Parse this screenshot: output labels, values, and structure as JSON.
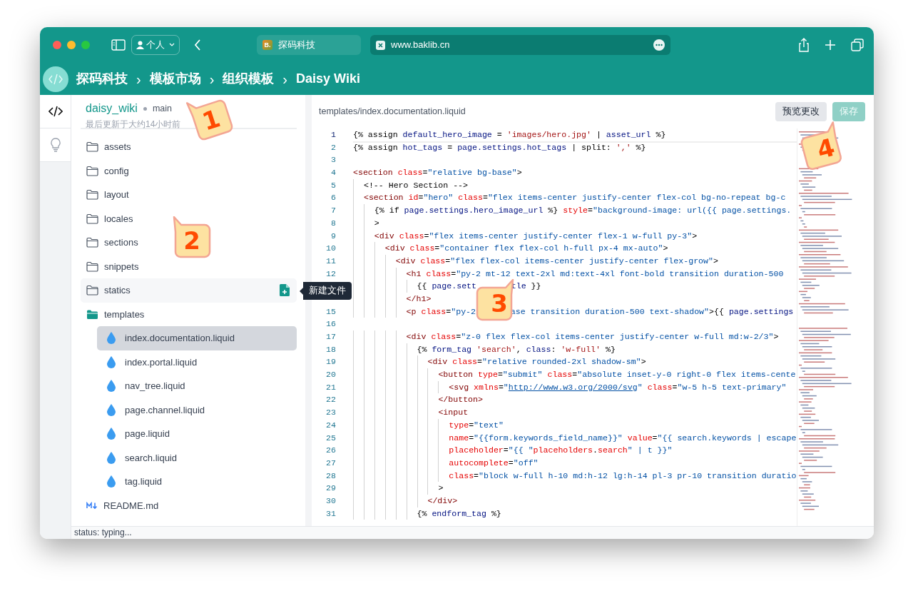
{
  "browser": {
    "profile": "个人",
    "tabs": [
      {
        "title": "探码科技",
        "icon_text": "B.",
        "selected": false
      },
      {
        "title": "www.baklib.cn",
        "selected": true
      }
    ]
  },
  "app_header": {
    "breadcrumb": [
      "探码科技",
      "模板市场",
      "组织模板",
      "Daisy Wiki"
    ],
    "separators": [
      "›",
      "›",
      "›"
    ]
  },
  "rail": [
    {
      "kind": "code",
      "selected": true
    },
    {
      "kind": "bulb",
      "selected": false
    }
  ],
  "repo": {
    "name": "daisy_wiki",
    "branch": "main",
    "updated": "最后更新于大约14小时前"
  },
  "tree": [
    {
      "name": "assets",
      "kind": "folder",
      "expanded": false,
      "selected": false,
      "hovered": false
    },
    {
      "name": "config",
      "kind": "folder",
      "expanded": false,
      "selected": false,
      "hovered": false
    },
    {
      "name": "layout",
      "kind": "folder",
      "expanded": false,
      "selected": false,
      "hovered": false
    },
    {
      "name": "locales",
      "kind": "folder",
      "expanded": false,
      "selected": false,
      "hovered": false
    },
    {
      "name": "sections",
      "kind": "folder",
      "expanded": false,
      "selected": false,
      "hovered": false
    },
    {
      "name": "snippets",
      "kind": "folder",
      "expanded": false,
      "selected": false,
      "hovered": false
    },
    {
      "name": "statics",
      "kind": "folder",
      "expanded": false,
      "selected": false,
      "hovered": true
    },
    {
      "name": "templates",
      "kind": "folder",
      "expanded": true,
      "selected": false,
      "hovered": false,
      "children": [
        {
          "name": "index.documentation.liquid",
          "kind": "liquid",
          "selected": true,
          "hovered": false
        },
        {
          "name": "index.portal.liquid",
          "kind": "liquid",
          "selected": false,
          "hovered": false
        },
        {
          "name": "nav_tree.liquid",
          "kind": "liquid",
          "selected": false,
          "hovered": false
        },
        {
          "name": "page.channel.liquid",
          "kind": "liquid",
          "selected": false,
          "hovered": false
        },
        {
          "name": "page.liquid",
          "kind": "liquid",
          "selected": false,
          "hovered": false
        },
        {
          "name": "search.liquid",
          "kind": "liquid",
          "selected": false,
          "hovered": false
        },
        {
          "name": "tag.liquid",
          "kind": "liquid",
          "selected": false,
          "hovered": false
        }
      ]
    },
    {
      "name": "README.md",
      "kind": "markdown",
      "selected": false,
      "hovered": false
    }
  ],
  "tooltip": "新建文件",
  "editor": {
    "path": "templates/index.documentation.liquid",
    "buttons": [
      {
        "label": "预览更改",
        "kind": "secondary",
        "disabled": false
      },
      {
        "label": "保存",
        "kind": "primary",
        "disabled": true
      }
    ],
    "lines": [
      {
        "number": "1",
        "selected": true,
        "tokens": [
          {
            "kind": "plain",
            "text": "{% assign "
          },
          {
            "kind": "var",
            "text": "default_hero_image"
          },
          {
            "kind": "plain",
            "text": " = "
          },
          {
            "kind": "lstr",
            "text": "'images/hero.jpg'"
          },
          {
            "kind": "plain",
            "text": " | "
          },
          {
            "kind": "var",
            "text": "asset_url"
          },
          {
            "kind": "plain",
            "text": " %}"
          }
        ]
      },
      {
        "number": "2",
        "selected": false,
        "tokens": [
          {
            "kind": "plain",
            "text": "{% assign "
          },
          {
            "kind": "var",
            "text": "hot_tags"
          },
          {
            "kind": "plain",
            "text": " = "
          },
          {
            "kind": "var",
            "text": "page.settings.hot_tags"
          },
          {
            "kind": "plain",
            "text": " | split: "
          },
          {
            "kind": "lstr",
            "text": "','"
          },
          {
            "kind": "plain",
            "text": " %}"
          }
        ]
      },
      {
        "number": "3",
        "selected": false
      },
      {
        "number": "4",
        "selected": false,
        "tokens": [
          {
            "kind": "tag",
            "text": "<section"
          },
          {
            "kind": "attr",
            "text": " class"
          },
          {
            "kind": "plain",
            "text": "="
          },
          {
            "kind": "str",
            "text": "\"relative bg-base\""
          },
          {
            "kind": "plain",
            "text": ">"
          }
        ]
      },
      {
        "number": "5",
        "selected": false,
        "tokens": [
          {
            "kind": "plain",
            "text": "  <!-- Hero Section -->"
          }
        ]
      },
      {
        "number": "6",
        "selected": false,
        "tokens": [
          {
            "kind": "tag",
            "text": "  <section"
          },
          {
            "kind": "attr",
            "text": " id"
          },
          {
            "kind": "plain",
            "text": "="
          },
          {
            "kind": "str",
            "text": "\"hero\""
          },
          {
            "kind": "attr",
            "text": " class"
          },
          {
            "kind": "plain",
            "text": "="
          },
          {
            "kind": "str",
            "text": "\"flex items-center justify-center flex-col bg-no-repeat bg-c"
          }
        ]
      },
      {
        "number": "7",
        "selected": false,
        "tokens": [
          {
            "kind": "plain",
            "text": "    {% if "
          },
          {
            "kind": "var",
            "text": "page.settings.hero_image_url"
          },
          {
            "kind": "plain",
            "text": " %} "
          },
          {
            "kind": "attr",
            "text": "style"
          },
          {
            "kind": "plain",
            "text": "="
          },
          {
            "kind": "str",
            "text": "\"background-image: url({{ page.settings."
          }
        ]
      },
      {
        "number": "8",
        "selected": false,
        "tokens": [
          {
            "kind": "plain",
            "text": "    >"
          }
        ]
      },
      {
        "number": "9",
        "selected": false,
        "tokens": [
          {
            "kind": "tag",
            "text": "    <div"
          },
          {
            "kind": "attr",
            "text": " class"
          },
          {
            "kind": "plain",
            "text": "="
          },
          {
            "kind": "str",
            "text": "\"flex items-center justify-center flex-1 w-full py-3\""
          },
          {
            "kind": "plain",
            "text": ">"
          }
        ]
      },
      {
        "number": "10",
        "selected": false,
        "tokens": [
          {
            "kind": "tag",
            "text": "      <div"
          },
          {
            "kind": "attr",
            "text": " class"
          },
          {
            "kind": "plain",
            "text": "="
          },
          {
            "kind": "str",
            "text": "\"container flex flex-col h-full px-4 mx-auto\""
          },
          {
            "kind": "plain",
            "text": ">"
          }
        ]
      },
      {
        "number": "11",
        "selected": false,
        "tokens": [
          {
            "kind": "tag",
            "text": "        <div"
          },
          {
            "kind": "attr",
            "text": " class"
          },
          {
            "kind": "plain",
            "text": "="
          },
          {
            "kind": "str",
            "text": "\"flex flex-col items-center justify-center flex-grow\""
          },
          {
            "kind": "plain",
            "text": ">"
          }
        ]
      },
      {
        "number": "12",
        "selected": false,
        "tokens": [
          {
            "kind": "tag",
            "text": "          <h1"
          },
          {
            "kind": "attr",
            "text": " class"
          },
          {
            "kind": "plain",
            "text": "="
          },
          {
            "kind": "str",
            "text": "\"py-2 mt-12 text-2xl md:text-4xl font-bold transition duration-500"
          }
        ]
      },
      {
        "selected": false,
        "tokens": [
          {
            "kind": "plain",
            "text": "            {{ "
          },
          {
            "kind": "var",
            "text": "page.sett"
          },
          {
            "kind": "covered"
          },
          {
            "kind": "var",
            "text": "tle"
          },
          {
            "kind": "plain",
            "text": " }}"
          }
        ]
      },
      {
        "selected": false,
        "tokens": [
          {
            "kind": "tag",
            "text": "          </h1>"
          }
        ]
      },
      {
        "number": "15",
        "selected": false,
        "tokens": [
          {
            "kind": "tag",
            "text": "          <p"
          },
          {
            "kind": "attr",
            "text": " class"
          },
          {
            "kind": "plain",
            "text": "="
          },
          {
            "kind": "str",
            "text": "\"py-2"
          },
          {
            "kind": "covered"
          },
          {
            "kind": "str",
            "text": "ase transition duration-500 text-shadow\""
          },
          {
            "kind": "plain",
            "text": ">{{ "
          },
          {
            "kind": "var",
            "text": "page.settings"
          }
        ]
      },
      {
        "number": "16",
        "selected": false
      },
      {
        "number": "17",
        "selected": false,
        "tokens": [
          {
            "kind": "tag",
            "text": "          <div"
          },
          {
            "kind": "attr",
            "text": " class"
          },
          {
            "kind": "plain",
            "text": "="
          },
          {
            "kind": "str",
            "text": "\"z-0 flex flex-col items-center justify-center w-full md:w-2/3\""
          },
          {
            "kind": "plain",
            "text": ">"
          }
        ]
      },
      {
        "number": "18",
        "selected": false,
        "tokens": [
          {
            "kind": "plain",
            "text": "            {% "
          },
          {
            "kind": "var",
            "text": "form_tag"
          },
          {
            "kind": "lstr",
            "text": " 'search'"
          },
          {
            "kind": "plain",
            "text": ", "
          },
          {
            "kind": "var",
            "text": "class"
          },
          {
            "kind": "plain",
            "text": ": "
          },
          {
            "kind": "lstr",
            "text": "'w-full'"
          },
          {
            "kind": "plain",
            "text": " %}"
          }
        ]
      },
      {
        "number": "19",
        "selected": false,
        "tokens": [
          {
            "kind": "tag",
            "text": "              <div"
          },
          {
            "kind": "attr",
            "text": " class"
          },
          {
            "kind": "plain",
            "text": "="
          },
          {
            "kind": "str",
            "text": "\"relative rounded-2xl shadow-sm\""
          },
          {
            "kind": "plain",
            "text": ">"
          }
        ]
      },
      {
        "number": "20",
        "selected": false,
        "tokens": [
          {
            "kind": "tag",
            "text": "                <button"
          },
          {
            "kind": "attr",
            "text": " type"
          },
          {
            "kind": "plain",
            "text": "="
          },
          {
            "kind": "str",
            "text": "\"submit\""
          },
          {
            "kind": "attr",
            "text": " class"
          },
          {
            "kind": "plain",
            "text": "="
          },
          {
            "kind": "str",
            "text": "\"absolute inset-y-0 right-0 flex items-cente"
          }
        ]
      },
      {
        "number": "21",
        "selected": false,
        "tokens": [
          {
            "kind": "tag",
            "text": "                  <svg"
          },
          {
            "kind": "attr",
            "text": " xmlns"
          },
          {
            "kind": "plain",
            "text": "="
          },
          {
            "kind": "str",
            "text": "\""
          },
          {
            "kind": "url",
            "text": "http://www.w3.org/2000/svg"
          },
          {
            "kind": "str",
            "text": "\""
          },
          {
            "kind": "attr",
            "text": " class"
          },
          {
            "kind": "plain",
            "text": "="
          },
          {
            "kind": "str",
            "text": "\"w-5 h-5 text-primary\""
          }
        ]
      },
      {
        "number": "22",
        "selected": false,
        "tokens": [
          {
            "kind": "tag",
            "text": "                </button>"
          }
        ]
      },
      {
        "number": "23",
        "selected": false,
        "tokens": [
          {
            "kind": "tag",
            "text": "                <input"
          }
        ]
      },
      {
        "number": "24",
        "selected": false,
        "tokens": [
          {
            "kind": "attr",
            "text": "                  type"
          },
          {
            "kind": "plain",
            "text": "="
          },
          {
            "kind": "str",
            "text": "\"text\""
          }
        ]
      },
      {
        "number": "25",
        "selected": false,
        "tokens": [
          {
            "kind": "attr",
            "text": "                  name"
          },
          {
            "kind": "plain",
            "text": "="
          },
          {
            "kind": "str",
            "text": "\"{{form.keywords_field_name}}\""
          },
          {
            "kind": "attr",
            "text": " value"
          },
          {
            "kind": "plain",
            "text": "="
          },
          {
            "kind": "str",
            "text": "\"{{ search.keywords | escape"
          }
        ]
      },
      {
        "number": "26",
        "selected": false,
        "tokens": [
          {
            "kind": "attr",
            "text": "                  placeholder"
          },
          {
            "kind": "plain",
            "text": "="
          },
          {
            "kind": "str",
            "text": "\"{{ \""
          },
          {
            "kind": "attr",
            "text": "placeholders"
          },
          {
            "kind": "plain",
            "text": "."
          },
          {
            "kind": "attr",
            "text": "search"
          },
          {
            "kind": "str",
            "text": "\" | t }}\""
          }
        ]
      },
      {
        "number": "27",
        "selected": false,
        "tokens": [
          {
            "kind": "attr",
            "text": "                  autocomplete"
          },
          {
            "kind": "plain",
            "text": "="
          },
          {
            "kind": "str",
            "text": "\"off\""
          }
        ]
      },
      {
        "number": "28",
        "selected": false,
        "tokens": [
          {
            "kind": "attr",
            "text": "                  class"
          },
          {
            "kind": "plain",
            "text": "="
          },
          {
            "kind": "str",
            "text": "\"block w-full h-10 md:h-12 lg:h-14 pl-3 pr-10 transition duratio"
          }
        ]
      },
      {
        "number": "29",
        "selected": false,
        "tokens": [
          {
            "kind": "plain",
            "text": "                >"
          }
        ]
      },
      {
        "number": "30",
        "selected": false,
        "tokens": [
          {
            "kind": "tag",
            "text": "              </div>"
          }
        ]
      },
      {
        "number": "31",
        "selected": false,
        "tokens": [
          {
            "kind": "plain",
            "text": "            {% "
          },
          {
            "kind": "var",
            "text": "endform_tag"
          },
          {
            "kind": "plain",
            "text": " %}"
          }
        ]
      }
    ]
  },
  "status_bar": "status: typing...",
  "callouts": [
    {
      "label": "1"
    },
    {
      "label": "2"
    },
    {
      "label": "3"
    },
    {
      "label": "4"
    }
  ]
}
